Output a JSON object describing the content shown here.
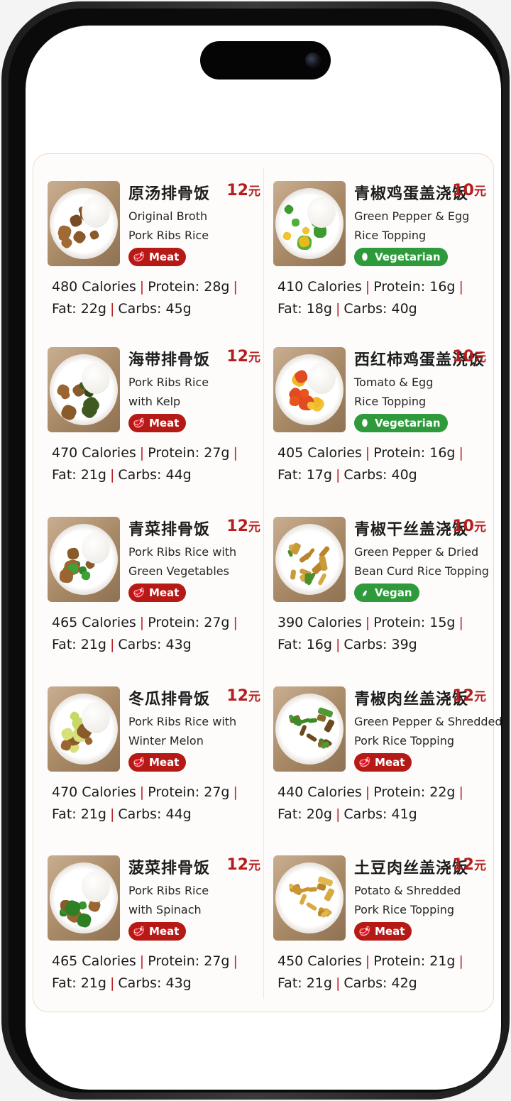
{
  "colors": {
    "accent": "#b61d1d",
    "meat_badge": "#b51a17",
    "veg_badge": "#2e9a3b",
    "card_border": "#f0d9bf"
  },
  "menu": {
    "currency": "元",
    "items": [
      {
        "zh": "原汤排骨饭",
        "price": "12",
        "en1": "Original Broth",
        "en2": "Pork Ribs Rice",
        "tag": "Meat",
        "tag_icon": "meat-icon",
        "calories": "480 Calories",
        "protein": "Protein: 28g",
        "fat": "Fat: 22g",
        "carbs": "Carbs: 45g",
        "food": "pork-ribs"
      },
      {
        "zh": "青椒鸡蛋盖浇饭",
        "price": "10",
        "en1": "Green Pepper & Egg",
        "en2": "Rice Topping",
        "tag": "Vegetarian",
        "tag_icon": "egg-icon",
        "calories": "410 Calories",
        "protein": "Protein: 16g",
        "fat": "Fat: 18g",
        "carbs": "Carbs: 40g",
        "food": "pepper-egg"
      },
      {
        "zh": "海带排骨饭",
        "price": "12",
        "en1": "Pork Ribs Rice",
        "en2": "with Kelp",
        "tag": "Meat",
        "tag_icon": "meat-icon",
        "calories": "470 Calories",
        "protein": "Protein: 27g",
        "fat": "Fat: 21g",
        "carbs": "Carbs: 44g",
        "food": "kelp-ribs"
      },
      {
        "zh": "西红柿鸡蛋盖浇饭",
        "price": "10",
        "en1": "Tomato & Egg",
        "en2": "Rice Topping",
        "tag": "Vegetarian",
        "tag_icon": "egg-icon",
        "calories": "405 Calories",
        "protein": "Protein: 16g",
        "fat": "Fat: 17g",
        "carbs": "Carbs: 40g",
        "food": "tomato-egg"
      },
      {
        "zh": "青菜排骨饭",
        "price": "12",
        "en1": "Pork Ribs Rice with",
        "en2": "Green Vegetables",
        "tag": "Meat",
        "tag_icon": "meat-icon",
        "calories": "465 Calories",
        "protein": "Protein: 27g",
        "fat": "Fat: 21g",
        "carbs": "Carbs: 43g",
        "food": "greens-ribs"
      },
      {
        "zh": "青椒干丝盖浇饭",
        "price": "10",
        "en1": "Green Pepper & Dried",
        "en2": "Bean Curd Rice Topping",
        "tag": "Vegan",
        "tag_icon": "sprout-icon",
        "calories": "390 Calories",
        "protein": "Protein: 15g",
        "fat": "Fat: 16g",
        "carbs": "Carbs: 39g",
        "food": "beancurd"
      },
      {
        "zh": "冬瓜排骨饭",
        "price": "12",
        "en1": "Pork Ribs Rice with",
        "en2": "Winter Melon",
        "tag": "Meat",
        "tag_icon": "meat-icon",
        "calories": "470 Calories",
        "protein": "Protein: 27g",
        "fat": "Fat: 21g",
        "carbs": "Carbs: 44g",
        "food": "melon-ribs"
      },
      {
        "zh": "青椒肉丝盖浇饭",
        "price": "12",
        "en1": "Green Pepper & Shredded",
        "en2": "Pork Rice Topping",
        "tag": "Meat",
        "tag_icon": "meat-icon",
        "calories": "440 Calories",
        "protein": "Protein: 22g",
        "fat": "Fat: 20g",
        "carbs": "Carbs: 41g",
        "food": "pepper-pork"
      },
      {
        "zh": "菠菜排骨饭",
        "price": "12",
        "en1": "Pork Ribs Rice",
        "en2": "with Spinach",
        "tag": "Meat",
        "tag_icon": "meat-icon",
        "calories": "465 Calories",
        "protein": "Protein: 27g",
        "fat": "Fat: 21g",
        "carbs": "Carbs: 43g",
        "food": "spinach-ribs"
      },
      {
        "zh": "土豆肉丝盖浇饭",
        "price": "12",
        "en1": "Potato & Shredded",
        "en2": "Pork Rice Topping",
        "tag": "Meat",
        "tag_icon": "meat-icon",
        "calories": "450 Calories",
        "protein": "Protein: 21g",
        "fat": "Fat: 21g",
        "carbs": "Carbs: 42g",
        "food": "potato-pork"
      }
    ]
  }
}
